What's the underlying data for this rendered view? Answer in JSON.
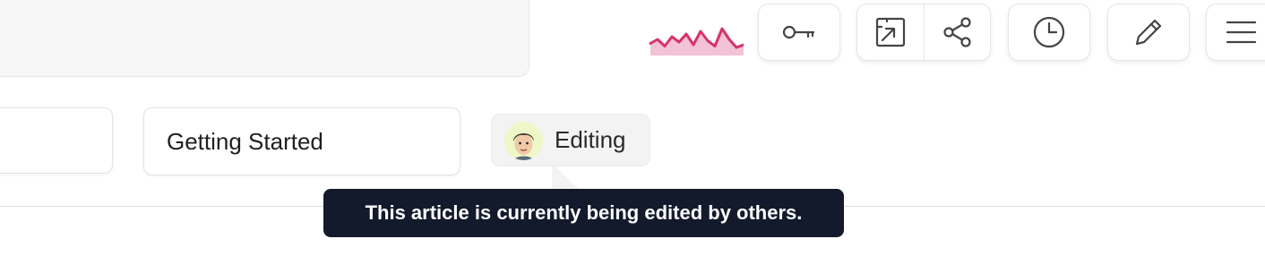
{
  "breadcrumb": {
    "collection_value": "",
    "title_value": "Getting Started"
  },
  "presence": {
    "status_label": "Editing",
    "tooltip": "This article is currently being edited by others."
  },
  "toolbar": {
    "buttons": [
      {
        "name": "api-key",
        "icon": "key-icon"
      },
      {
        "name": "open-external",
        "icon": "open-external-icon"
      },
      {
        "name": "share",
        "icon": "share-icon"
      },
      {
        "name": "history",
        "icon": "clock-icon"
      },
      {
        "name": "edit",
        "icon": "pencil-icon"
      },
      {
        "name": "menu",
        "icon": "hamburger-menu-icon"
      }
    ]
  },
  "activity": {
    "color": "#d6336c",
    "levels": [
      0.45,
      0.6,
      0.35,
      0.7,
      0.5,
      0.8,
      0.4,
      0.9,
      0.55,
      0.35,
      1.0,
      0.6,
      0.3,
      0.4
    ]
  },
  "colors": {
    "tooltip_bg": "#121a2b",
    "activity": "#d6336c",
    "avatar_bg": "#eef7c7"
  }
}
